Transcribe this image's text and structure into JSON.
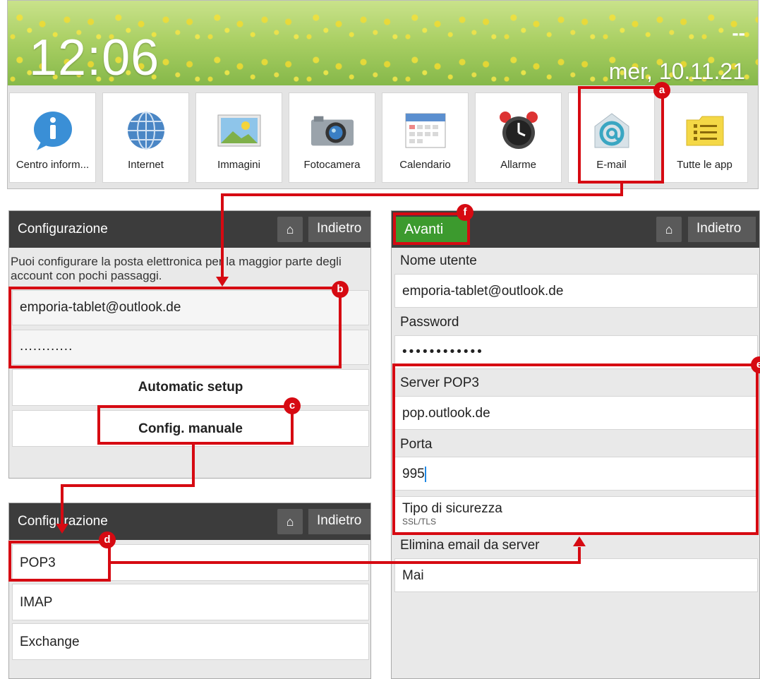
{
  "home": {
    "time": "12:06",
    "date": "mer, 10.11.21",
    "dash": "--",
    "tiles": [
      {
        "label": "Centro inform...",
        "icon": "info-icon"
      },
      {
        "label": "Internet",
        "icon": "globe-icon"
      },
      {
        "label": "Immagini",
        "icon": "image-icon"
      },
      {
        "label": "Fotocamera",
        "icon": "camera-icon"
      },
      {
        "label": "Calendario",
        "icon": "calendar-icon"
      },
      {
        "label": "Allarme",
        "icon": "alarm-clock-icon"
      },
      {
        "label": "E-mail",
        "icon": "email-at-icon"
      },
      {
        "label": "Tutte le app",
        "icon": "folder-list-icon"
      }
    ]
  },
  "setup1": {
    "title": "Configurazione",
    "back": "Indietro",
    "description": "Puoi configurare la posta elettronica per la maggior parte degli account con pochi passaggi.",
    "email_value": "emporia-tablet@outlook.de",
    "password_value": "............",
    "auto_button": "Automatic setup",
    "manual_button": "Config. manuale"
  },
  "setup2": {
    "title": "Configurazione",
    "back": "Indietro",
    "options": [
      "POP3",
      "IMAP",
      "Exchange"
    ]
  },
  "server": {
    "next_button": "Avanti",
    "back": "Indietro",
    "username_label": "Nome utente",
    "username_value": "emporia-tablet@outlook.de",
    "password_label": "Password",
    "password_value": "••••••••••••",
    "server_label": "Server POP3",
    "server_value": "pop.outlook.de",
    "port_label": "Porta",
    "port_value": "995",
    "security_label": "Tipo di sicurezza",
    "security_value": "SSL/TLS",
    "delete_label": "Elimina email da server",
    "delete_value": "Mai"
  },
  "badges": {
    "a": "a",
    "b": "b",
    "c": "c",
    "d": "d",
    "e": "e",
    "f": "f"
  },
  "colors": {
    "highlight": "#d60a12",
    "titlebar": "#3c3c3c",
    "avanti": "#3c9a2e"
  }
}
